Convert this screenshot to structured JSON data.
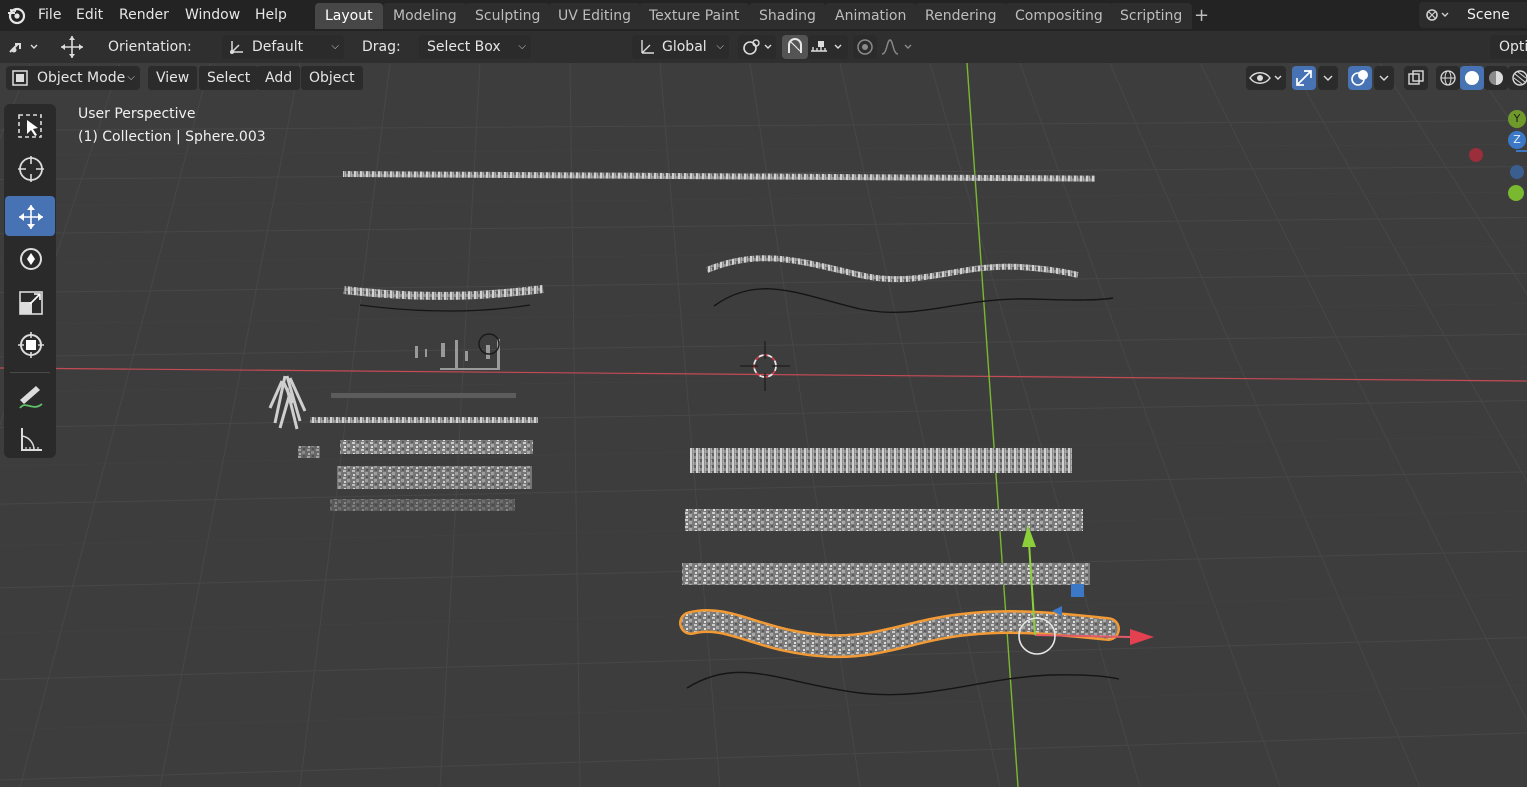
{
  "menu": [
    "File",
    "Edit",
    "Render",
    "Window",
    "Help"
  ],
  "workspace_tabs": [
    "Layout",
    "Modeling",
    "Sculpting",
    "UV Editing",
    "Texture Paint",
    "Shading",
    "Animation",
    "Rendering",
    "Compositing",
    "Scripting"
  ],
  "active_tab": "Layout",
  "add_tab_glyph": "+",
  "scene": {
    "label": "Scene"
  },
  "options_label": "Opti",
  "toolbar": {
    "orientation_label": "Orientation:",
    "orientation_value": "Default",
    "drag_label": "Drag:",
    "drag_value": "Select Box",
    "transform_orientation": "Global"
  },
  "viewport_header": {
    "mode": "Object Mode",
    "menus": [
      "View",
      "Select",
      "Add",
      "Object"
    ]
  },
  "overlay": {
    "perspective": "User Perspective",
    "collection": "(1) Collection | Sphere.003"
  },
  "gizmo": {
    "y_label": "Y",
    "z_label": "Z"
  },
  "colors": {
    "x_axis": "#c44a55",
    "y_axis": "#7ab82f",
    "z_axis": "#3b78c6",
    "selection": "#f19a35",
    "active_tool": "#4772b3",
    "background": "#3d3d3d"
  },
  "tools": [
    "select-box-icon",
    "cursor-icon",
    "move-icon",
    "rotate-icon",
    "scale-icon",
    "transform-icon",
    "annotate-icon",
    "measure-icon"
  ],
  "active_tool": "move-icon"
}
